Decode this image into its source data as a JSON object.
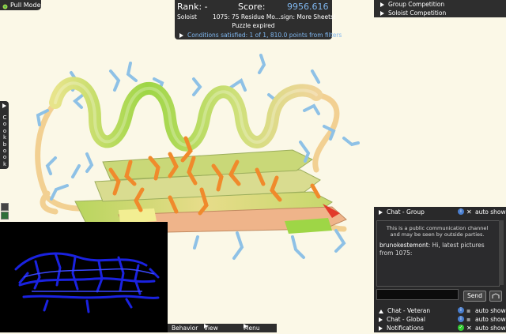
{
  "pull_mode": {
    "label": "Pull Mode",
    "icon": "pull-hand-icon"
  },
  "score_panel": {
    "rank_label": "Rank: -",
    "score_label": "Score:",
    "score_value": "9956.616",
    "mode": "Soloist",
    "puzzle_title": "1075: 75 Residue Mo...sign: More Sheets!",
    "status": "Puzzle expired",
    "conditions": "Conditions satisfied: 1 of 1, 810.0 points from filters"
  },
  "competitions": [
    {
      "label": "Group Competition"
    },
    {
      "label": "Soloist Competition"
    }
  ],
  "cookbook": {
    "label": "Cookbook"
  },
  "bottom_bar": {
    "behavior": "Behavior",
    "view": "View",
    "menu": "Menu"
  },
  "chat": {
    "group": {
      "label": "Chat - Group",
      "auto_show": "auto show"
    },
    "notice": "This is a public communication channel and may be seen by outside parties.",
    "message": {
      "user": "brunokestemont",
      "text": "Hi, latest pictures from 1075:"
    },
    "input_value": "",
    "send_label": "Send",
    "veteran": {
      "label": "Chat - Veteran",
      "auto_show": "auto show"
    },
    "global": {
      "label": "Chat - Global",
      "auto_show": "auto show"
    },
    "notifications": {
      "label": "Notifications",
      "auto_show": "auto show"
    }
  },
  "colors": {
    "background": "#fbf8e7",
    "score_blue": "#7fb6ee",
    "helix_green": "#9ed646",
    "helix_yellow": "#e4e484",
    "sheet_orange": "#f08a2c",
    "sidechain_blue": "#8ec1e6",
    "minimap_blue": "#1a22e0"
  }
}
